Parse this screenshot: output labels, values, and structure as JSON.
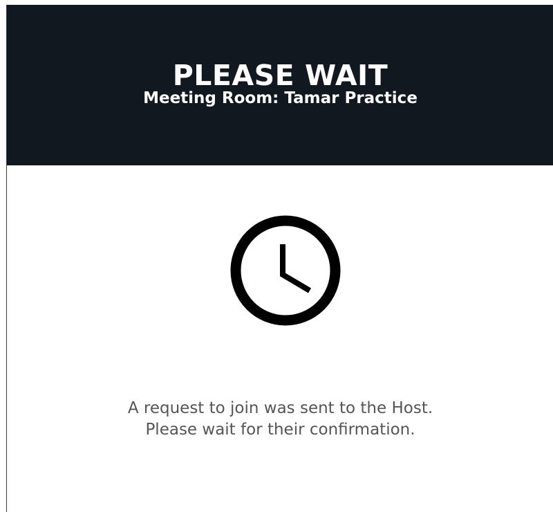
{
  "header": {
    "title": "PLEASE WAIT",
    "subtitle": "Meeting Room: Tamar Practice",
    "background": "#111820"
  },
  "status": {
    "icon": "clock-icon",
    "line1": "A request to join was sent to the Host.",
    "line2": "Please wait for their confirmation."
  }
}
